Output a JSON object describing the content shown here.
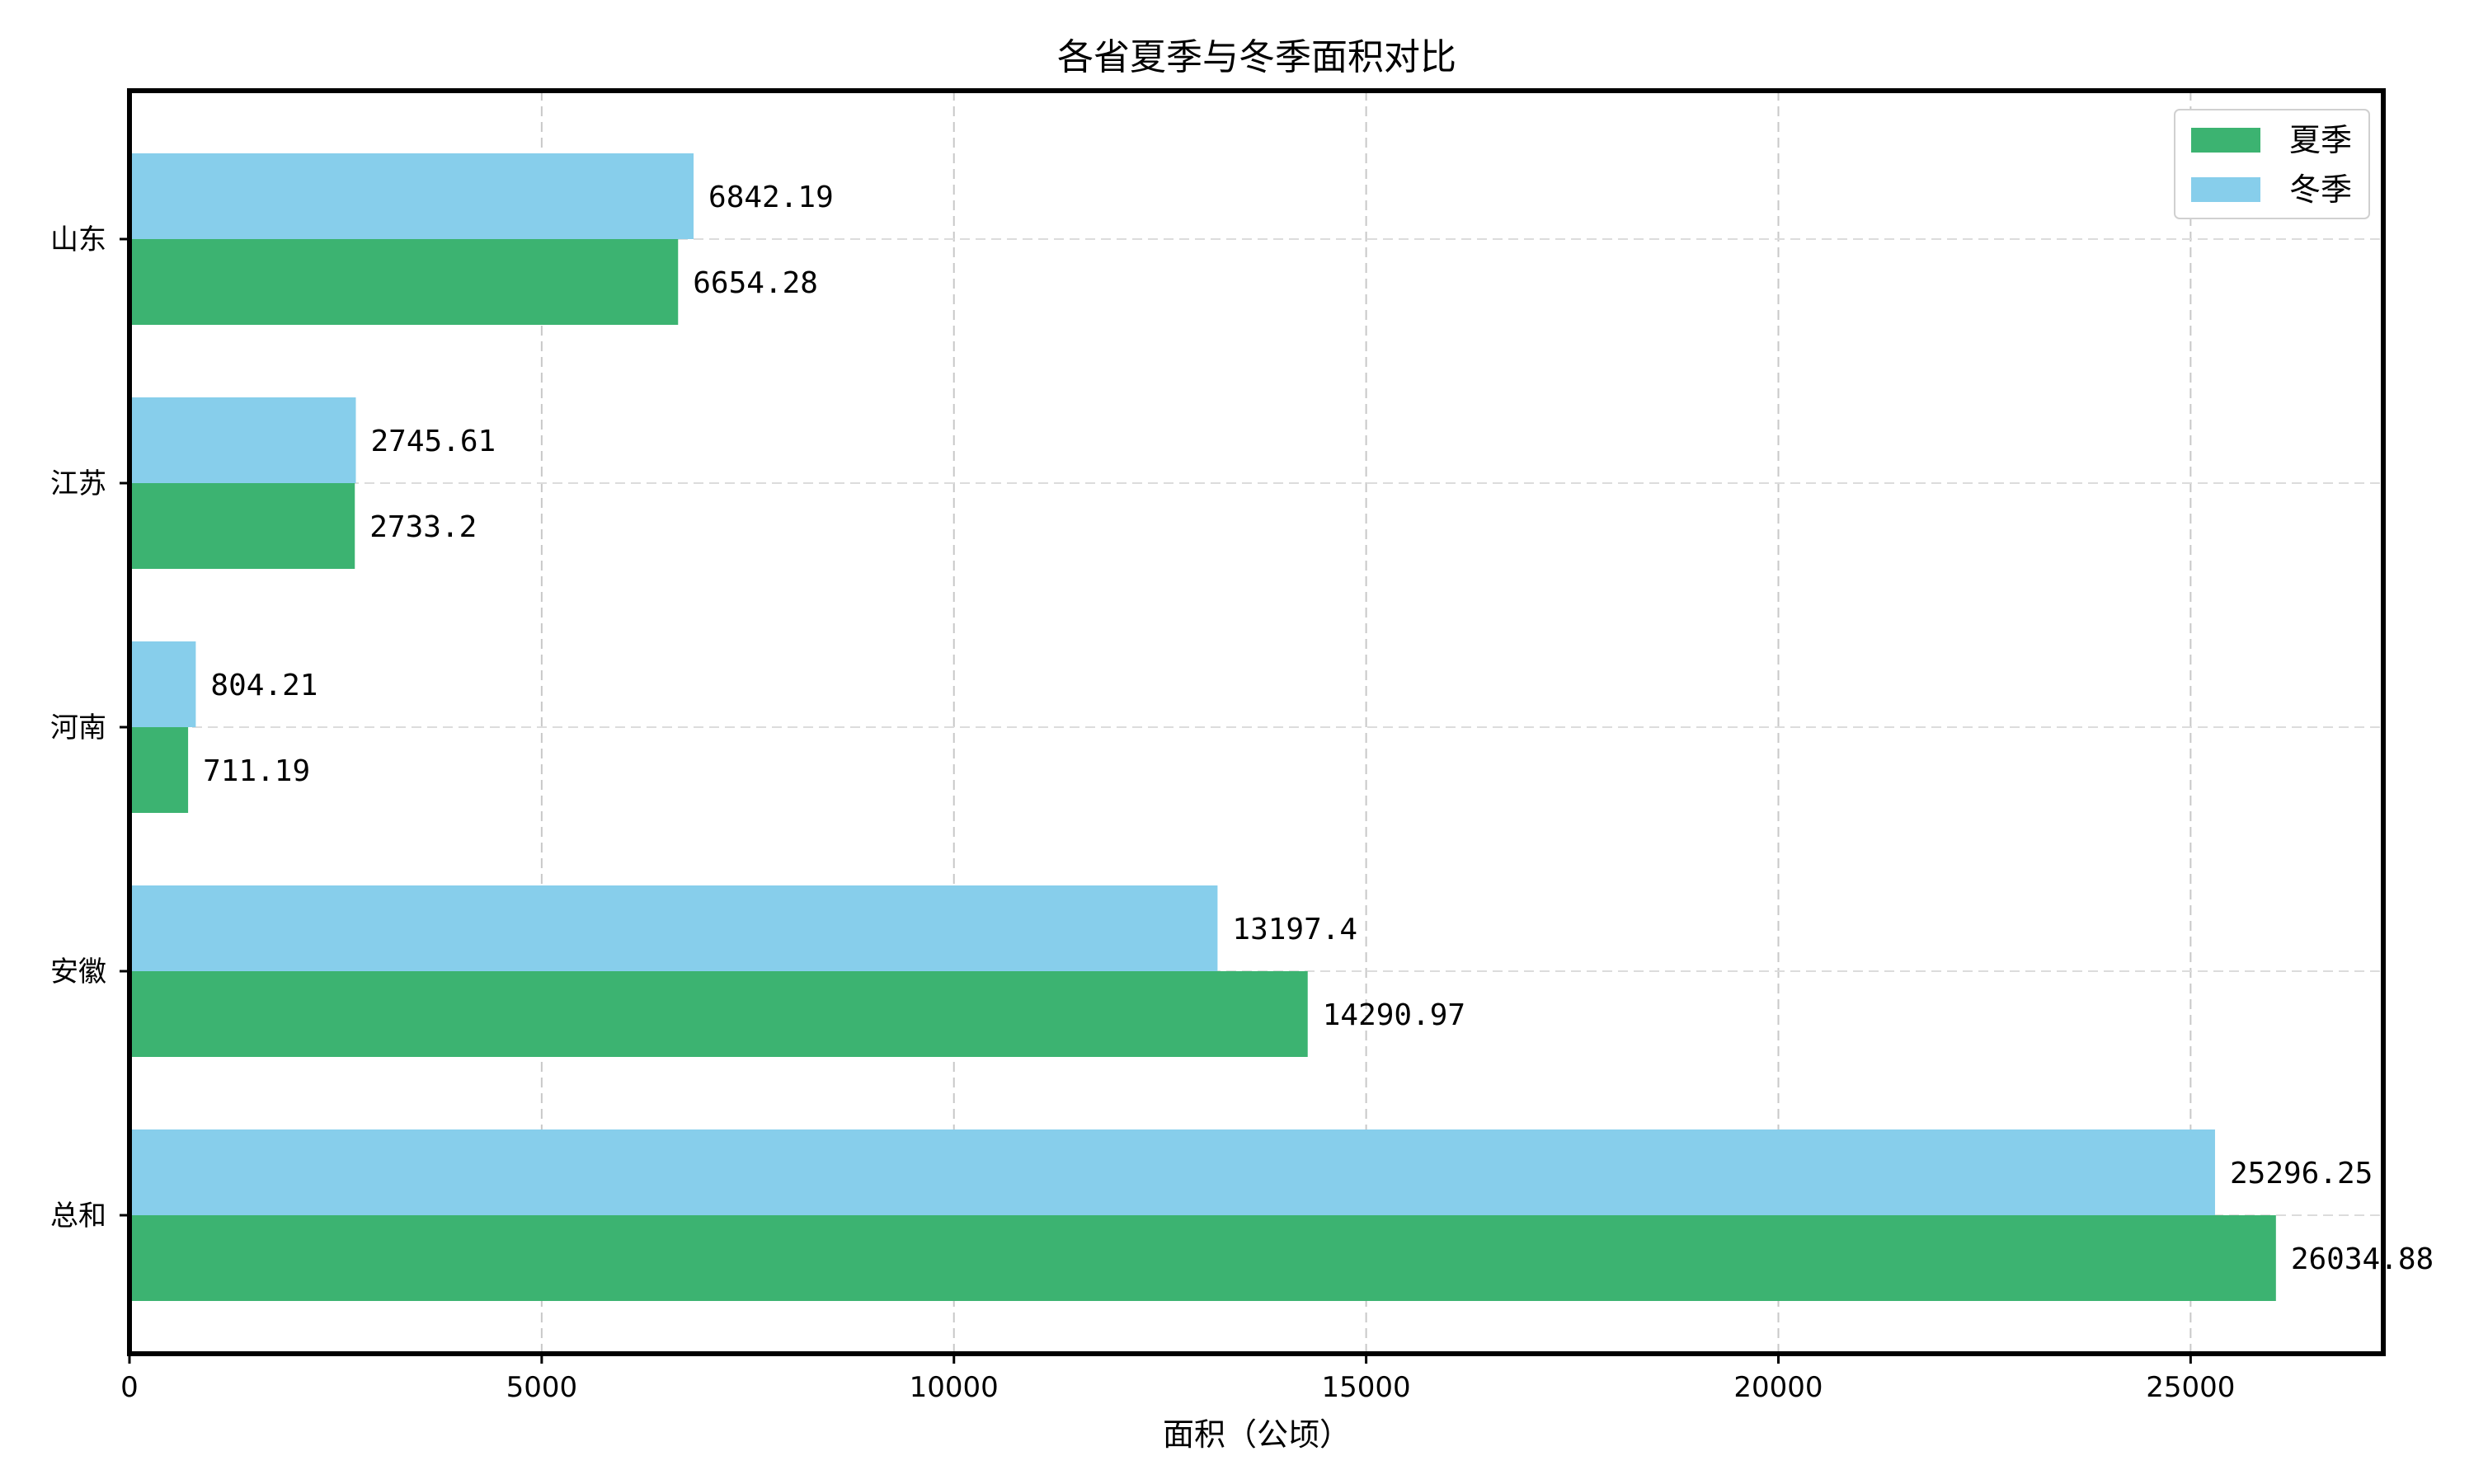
{
  "chart_data": {
    "type": "bar",
    "orientation": "horizontal",
    "title": "各省夏季与冬季面积对比",
    "xlabel": "面积（公顷）",
    "ylabel": "",
    "categories": [
      "山东",
      "江苏",
      "河南",
      "安徽",
      "总和"
    ],
    "series": [
      {
        "name": "夏季",
        "color": "#3cb371",
        "values": [
          6654.28,
          2733.2,
          711.19,
          14290.97,
          26034.88
        ],
        "labels": [
          "6654.28",
          "2733.2",
          "711.19",
          "14290.97",
          "26034.88"
        ]
      },
      {
        "name": "冬季",
        "color": "#87ceeb",
        "values": [
          6842.19,
          2745.61,
          804.21,
          13197.4,
          25296.25
        ],
        "labels": [
          "6842.19",
          "2745.61",
          "804.21",
          "13197.4",
          "25296.25"
        ]
      }
    ],
    "xlim": [
      0,
      27337
    ],
    "xticks": [
      0,
      5000,
      10000,
      15000,
      20000,
      25000
    ],
    "xtick_labels": [
      "0",
      "5000",
      "10000",
      "15000",
      "20000",
      "25000"
    ],
    "grid": true,
    "legend_position": "top-right"
  }
}
